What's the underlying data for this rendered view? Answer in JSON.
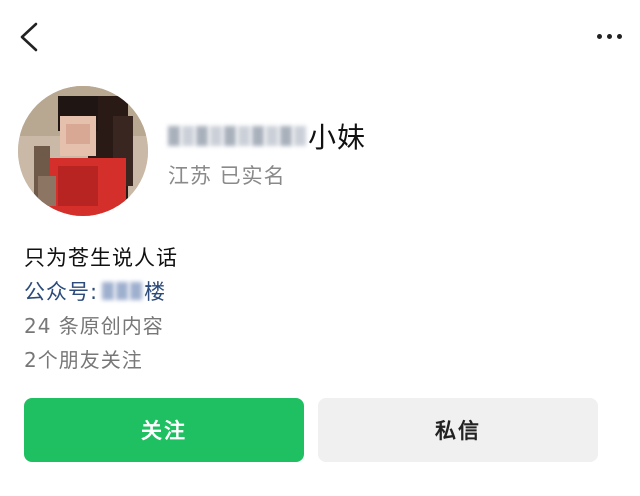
{
  "header": {
    "back_icon": "back-arrow-icon",
    "more_icon": "more-dots-icon"
  },
  "profile": {
    "name_visible_part": "小妹",
    "location_verified": "江苏 已实名",
    "bio": "只为苍生说人话",
    "official_account_label": "公众号:",
    "official_account_name_visible": "楼",
    "original_count": "24 条原创内容",
    "friends_follow": "2个朋友关注"
  },
  "actions": {
    "follow_label": "关注",
    "message_label": "私信"
  },
  "colors": {
    "accent_green": "#1fc061",
    "link_blue": "#2c4a7a",
    "secondary_gray": "#8a8a8a"
  }
}
